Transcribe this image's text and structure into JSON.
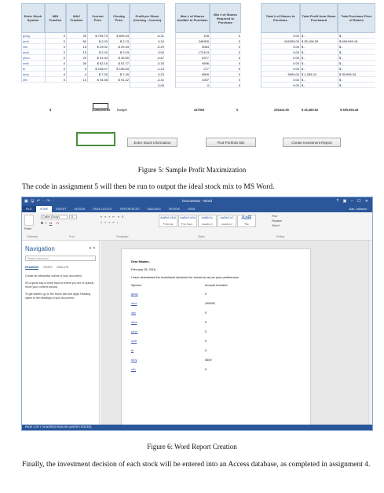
{
  "spreadsheet": {
    "headers": [
      "Enter Stock Symbol",
      "MIN Fraction",
      "MAX Fraction",
      "Current Price",
      "Closing Price",
      "Profit per Share (Closing - Current)",
      "Max # of Shares Availble to Purchase",
      "Min # of Shares Required to Purchase",
      "Total # of Shares to Purchase",
      "Total Profit from Share Purchased",
      "Total Purchase Price of Shares"
    ],
    "symbols": [
      "goog",
      "amd",
      "intc",
      "amd",
      "yhoo",
      "msft",
      "fb",
      "bbry",
      "nflx"
    ],
    "min": [
      "0",
      "0",
      "0",
      "0",
      "0",
      "0",
      "0",
      "0",
      "0"
    ],
    "max": [
      "30",
      "50",
      "15",
      "15",
      "20",
      "30",
      "5",
      "4",
      "10"
    ],
    "current": [
      "$ 705.73",
      "$ 2.03",
      "$ 29.02",
      "$ 2.03",
      "$ 31.34",
      "$ 52.10",
      "$ 108.07",
      "$ 7.26",
      "$ 94.55"
    ],
    "closing": [
      "$ 699.44",
      "$ 2.13",
      "$ 29.33",
      "$ 2.03",
      "$ 30.69",
      "$ 51.77",
      "$ 106.84",
      "$ 7.49",
      "$ 91.22"
    ],
    "profit": [
      "-6.31",
      "0.10",
      "-0.29",
      "0.00",
      "-0.67",
      "-0.33",
      "-1.23",
      "0.23",
      "-3.31",
      "0.00"
    ],
    "max_shares": [
      "425",
      "246305",
      "5064",
      "172413",
      "6377",
      "9596",
      "277",
      "5509",
      "1057",
      "0"
    ],
    "min_shares": [
      "0",
      "0",
      "0",
      "0",
      "0",
      "0",
      "0",
      "0",
      "0",
      "0"
    ],
    "total_shares": [
      "0.00",
      "246305.00",
      "0.00",
      "0.00",
      "0.00",
      "0.00",
      "0.00",
      "5509.00",
      "0.00",
      "0.00"
    ],
    "total_profit": [
      "$ -",
      "$ 25,108.28",
      "$ -",
      "$ -",
      "$ -",
      "$ -",
      "$ -",
      "$ 1,283.24",
      "$ -",
      "$ -"
    ],
    "total_price": [
      "$ -",
      "$ 499,999.15",
      "$ -",
      "$ -",
      "$ -",
      "$ -",
      "$ -",
      "$ 39,995.34",
      "$ -",
      "$ -"
    ],
    "sum_dollar": "$",
    "budget_value": "1,000,000.00",
    "budget_label": "Budget",
    "sum_max_shares": "447903",
    "sum_min_shares": "0",
    "sum_total_shares": "251814.00",
    "sum_total_profit": "$ 26,389.52",
    "sum_total_price": "$ 539,994.49",
    "buttons": [
      "Enter Stock Information",
      "Find Portfolio Mix",
      "Create Investment Report"
    ]
  },
  "figure5_caption": "Figure 5: Sample Profit Maximization",
  "para1": "The code in assignment 5 will then be run to output the ideal stock mix to MS Word.",
  "word": {
    "title": "Document1 - Word",
    "window_controls": "? ▣ – ☐ ✕",
    "quick_access": "▣ 🖫 ↶ · ↷ ·",
    "tabs": [
      "FILE",
      "HOME",
      "INSERT",
      "DESIGN",
      "PAGE LAYOUT",
      "REFERENCES",
      "MAILINGS",
      "REVIEW",
      "VIEW"
    ],
    "user": "Nan, Johnson ·",
    "font_name": "Calibri (Body)",
    "font_size": "11",
    "styles": [
      {
        "sample": "AaBbCcDd",
        "name": "¶ Normal"
      },
      {
        "sample": "AaBbCcDd",
        "name": "¶ No Spac..."
      },
      {
        "sample": "AaBbCc",
        "name": "Heading 1"
      },
      {
        "sample": "AaBbCcC",
        "name": "Heading 2"
      },
      {
        "sample": "AaB",
        "name": "Title"
      }
    ],
    "groups": [
      "Clipboard",
      "Font",
      "Paragraph",
      "Styles",
      "Editing"
    ],
    "editing": [
      "Find ·",
      "Replace",
      "Select ·"
    ],
    "paste_label": "Paste",
    "nav": {
      "title": "Navigation",
      "search_placeholder": "Search document",
      "tabs": [
        "HEADINGS",
        "PAGES",
        "RESULTS"
      ],
      "p1": "Create an interactive outline of your document.",
      "p2": "It's a great way to keep track of where you are or quickly move your content around.",
      "p3": "To get started, go to the Home tab and apply Heading styles to the headings in your document."
    },
    "doc": {
      "greeting": "Dear Madam,",
      "date": "February 28, 2016,",
      "intro": "I have determined the investment decisions for tomorrow as per your preferences.",
      "col_symbol": "Symbol",
      "col_amount": "Amount Invested",
      "rows": [
        {
          "symbol": "goog",
          "amount": "0"
        },
        {
          "symbol": "amd",
          "amount": "246305"
        },
        {
          "symbol": "intc",
          "amount": "0"
        },
        {
          "symbol": "amd",
          "amount": "0"
        },
        {
          "symbol": "yhoo",
          "amount": "0"
        },
        {
          "symbol": "msft",
          "amount": "0"
        },
        {
          "symbol": "fb",
          "amount": "0"
        },
        {
          "symbol": "bbry",
          "amount": "5509"
        },
        {
          "symbol": "nflx",
          "amount": "0"
        }
      ]
    },
    "status": "PAGE 1 OF 1    76 WORDS    ENGLISH (UNITED STATES)"
  },
  "figure6_caption": "Figure 6: Word Report Creation",
  "para2": "Finally, the investment decision of each stock will be entered into an Access database, as completed in assignment 4."
}
